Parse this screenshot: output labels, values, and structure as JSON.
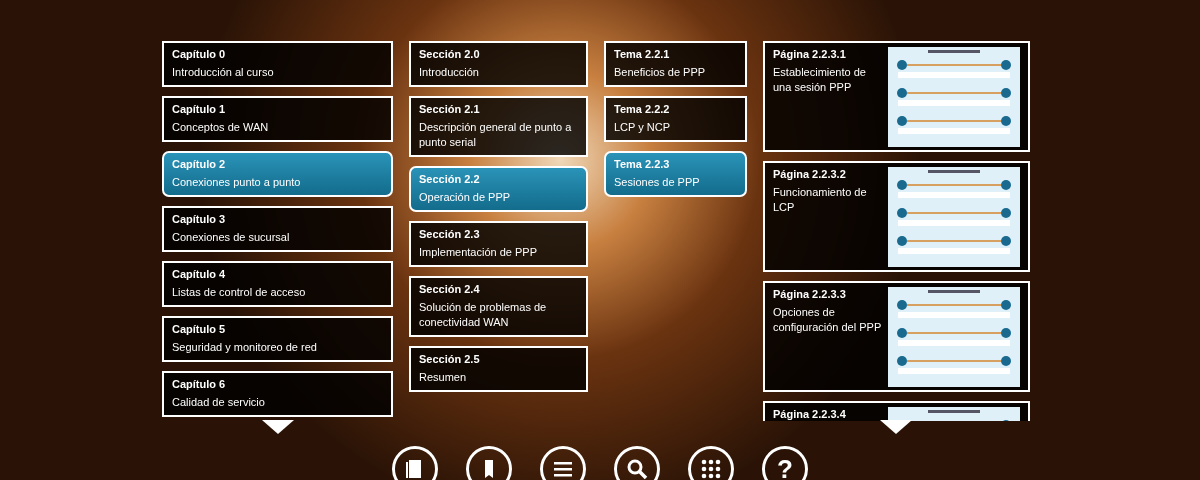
{
  "columns": [
    {
      "kind": "text",
      "scroll_down": true,
      "items": [
        {
          "heading": "Capítulo 0",
          "title": "Introducción al curso",
          "selected": false
        },
        {
          "heading": "Capítulo 1",
          "title": "Conceptos de WAN",
          "selected": false
        },
        {
          "heading": "Capítulo 2",
          "title": "Conexiones punto a punto",
          "selected": true
        },
        {
          "heading": "Capítulo 3",
          "title": "Conexiones de sucursal",
          "selected": false
        },
        {
          "heading": "Capítulo 4",
          "title": "Listas de control de acceso",
          "selected": false
        },
        {
          "heading": "Capítulo 5",
          "title": "Seguridad y monitoreo de red",
          "selected": false
        },
        {
          "heading": "Capítulo 6",
          "title": "Calidad de servicio",
          "selected": false
        }
      ]
    },
    {
      "kind": "text",
      "scroll_down": false,
      "items": [
        {
          "heading": "Sección 2.0",
          "title": "Introducción",
          "selected": false
        },
        {
          "heading": "Sección 2.1",
          "title": "Descripción general de punto a punto serial",
          "selected": false
        },
        {
          "heading": "Sección 2.2",
          "title": "Operación de PPP",
          "selected": true
        },
        {
          "heading": "Sección 2.3",
          "title": "Implementación de PPP",
          "selected": false
        },
        {
          "heading": "Sección 2.4",
          "title": "Solución de problemas de conectividad WAN",
          "selected": false
        },
        {
          "heading": "Sección 2.5",
          "title": "Resumen",
          "selected": false
        }
      ]
    },
    {
      "kind": "text",
      "scroll_down": false,
      "items": [
        {
          "heading": "Tema 2.2.1",
          "title": "Beneficios de PPP",
          "selected": false
        },
        {
          "heading": "Tema 2.2.2",
          "title": "LCP y NCP",
          "selected": false
        },
        {
          "heading": "Tema 2.2.3",
          "title": "Sesiones de PPP",
          "selected": true
        }
      ]
    },
    {
      "kind": "page",
      "scroll_down": true,
      "items": [
        {
          "heading": "Página 2.2.3.1",
          "title": "Establecimiento de una sesión PPP",
          "selected": false
        },
        {
          "heading": "Página 2.2.3.2",
          "title": "Funcionamiento de LCP",
          "selected": false
        },
        {
          "heading": "Página 2.2.3.3",
          "title": "Opciones de configuración del PPP",
          "selected": false
        },
        {
          "heading": "Página 2.2.3.4",
          "selected": false
        }
      ]
    }
  ],
  "toolbar": [
    {
      "kind": "book"
    },
    {
      "kind": "bookmark"
    },
    {
      "kind": "menu"
    },
    {
      "kind": "search"
    },
    {
      "kind": "grid"
    },
    {
      "kind": "text",
      "label": "?"
    }
  ]
}
